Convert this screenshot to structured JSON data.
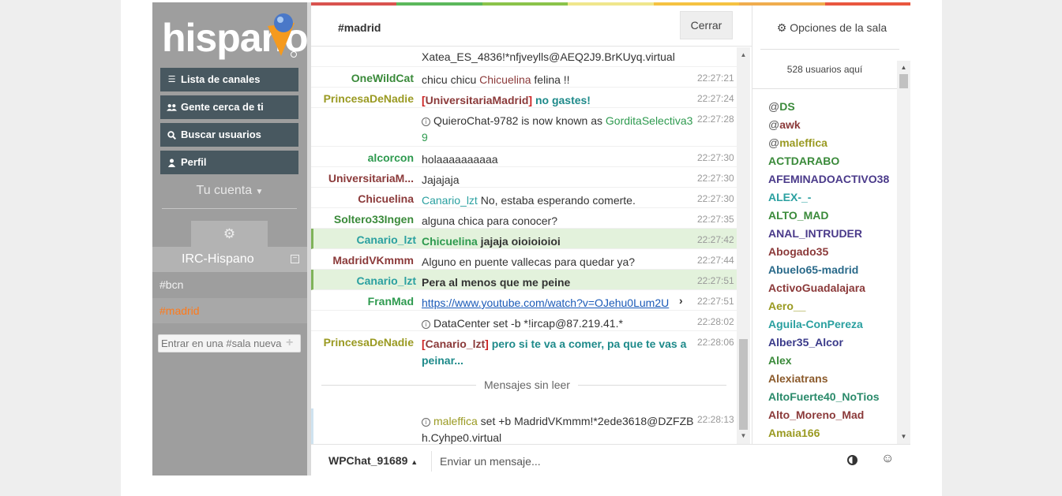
{
  "sidebar": {
    "logo_text": "hispano",
    "nav": [
      {
        "label": "Lista de canales",
        "icon": "list-icon"
      },
      {
        "label": "Gente cerca de ti",
        "icon": "users-icon"
      },
      {
        "label": "Buscar usuarios",
        "icon": "search-icon"
      },
      {
        "label": "Perfil",
        "icon": "user-icon"
      }
    ],
    "account_label": "Tu cuenta",
    "network_name": "IRC-Hispano",
    "channels": [
      "#bcn",
      "#madrid"
    ],
    "join_placeholder": "Entrar en una #sala nueva"
  },
  "header": {
    "channel": "#madrid",
    "close_label": "Cerrar"
  },
  "colors": {
    "bar": [
      "#d9534f",
      "#5cb85c",
      "#8bc34a",
      "#f0e68c",
      "#f5c242",
      "#f0ad4e",
      "#e9573f"
    ]
  },
  "messages": [
    {
      "nick": "",
      "text": "Xatea_ES_4836!*nfjveylls@AEQ2J9.BrKUyq.virtual",
      "time": ""
    },
    {
      "nick": "OneWildCat",
      "text1": "chicu chicu ",
      "mention": "Chicuelina",
      "text2": " felina !!",
      "time": "22:27:21"
    },
    {
      "nick": "PrincesaDeNadie",
      "bracket_nick": "UniversitariaMadrid",
      "text": " no gastes!",
      "time": "22:27:24"
    },
    {
      "info_text": "QuieroChat-9782 is now known as ",
      "info_nick": "GorditaSelectiva39",
      "time": "22:27:28"
    },
    {
      "nick": "alcorcon",
      "text": "holaaaaaaaaaa",
      "time": "22:27:30"
    },
    {
      "nick": "UniversitariaM...",
      "text": "Jajajaja",
      "time": "22:27:30"
    },
    {
      "nick": "Chicuelina",
      "mention": "Canario_lzt",
      "text": " No, estaba esperando comerte.",
      "time": "22:27:30"
    },
    {
      "nick": "Soltero33Ingen",
      "text": "alguna chica para conocer?",
      "time": "22:27:35"
    },
    {
      "nick": "Canario_lzt",
      "mention": "Chicuelina",
      "text": " jajaja oioioioioi",
      "time": "22:27:42"
    },
    {
      "nick": "MadridVKmmm",
      "text": "Alguno en puente vallecas para quedar ya?",
      "time": "22:27:44"
    },
    {
      "nick": "Canario_lzt",
      "text": "Pera al menos que me peine",
      "time": "22:27:51"
    },
    {
      "nick": "FranMad",
      "link": "https://www.youtube.com/watch?v=OJehu0Lum2U",
      "time": "22:27:51"
    },
    {
      "info_text": "DataCenter set -b *!ircap@87.219.41.*",
      "time": "22:28:02"
    },
    {
      "nick": "PrincesaDeNadie",
      "bracket_nick": "Canario_lzt",
      "text": " pero si te va a comer, pa que te vas a peinar...",
      "time": "22:28:06"
    },
    {
      "info_nick": "maleffica",
      "info_text": " set +b MadridVKmmm!*2ede3618@DZFZBh.Cyhpe0.virtual",
      "time": "22:28:13"
    }
  ],
  "unread_label": "Mensajes sin leer",
  "room": {
    "options_label": "Opciones de la sala",
    "user_count": "528 usuarios aquí",
    "users": [
      {
        "prefix": "@",
        "name": "DS",
        "color": "#3a8a3a"
      },
      {
        "prefix": "@",
        "name": "awk",
        "color": "#8b3a3a"
      },
      {
        "prefix": "@",
        "name": "maleffica",
        "color": "#9a9a22"
      },
      {
        "prefix": "",
        "name": "ACTDARABO",
        "color": "#3a8a3a"
      },
      {
        "prefix": "",
        "name": "AFEMINADOACTIVO38",
        "color": "#4a3a8a"
      },
      {
        "prefix": "",
        "name": "ALEX-_-",
        "color": "#2aa0a0"
      },
      {
        "prefix": "",
        "name": "ALTO_MAD",
        "color": "#3a8a3a"
      },
      {
        "prefix": "",
        "name": "ANAL_INTRUDER",
        "color": "#4a3a8a"
      },
      {
        "prefix": "",
        "name": "Abogado35",
        "color": "#8b3a3a"
      },
      {
        "prefix": "",
        "name": "Abuelo65-madrid",
        "color": "#2a6a8a"
      },
      {
        "prefix": "",
        "name": "ActivoGuadalajara",
        "color": "#8b3a3a"
      },
      {
        "prefix": "",
        "name": "Aero__",
        "color": "#9a9a22"
      },
      {
        "prefix": "",
        "name": "Aguila-ConPereza",
        "color": "#2aa0a0"
      },
      {
        "prefix": "",
        "name": "Alber35_Alcor",
        "color": "#3a3a8a"
      },
      {
        "prefix": "",
        "name": "Alex",
        "color": "#3a8a3a"
      },
      {
        "prefix": "",
        "name": "Alexiatrans",
        "color": "#8b5a2b"
      },
      {
        "prefix": "",
        "name": "AltoFuerte40_NoTios",
        "color": "#2a8a6a"
      },
      {
        "prefix": "",
        "name": "Alto_Moreno_Mad",
        "color": "#8b3a3a"
      },
      {
        "prefix": "",
        "name": "Amaia166",
        "color": "#9a9a22"
      }
    ]
  },
  "bottom": {
    "my_nick": "WPChat_91689",
    "message_placeholder": "Enviar un mensaje..."
  }
}
